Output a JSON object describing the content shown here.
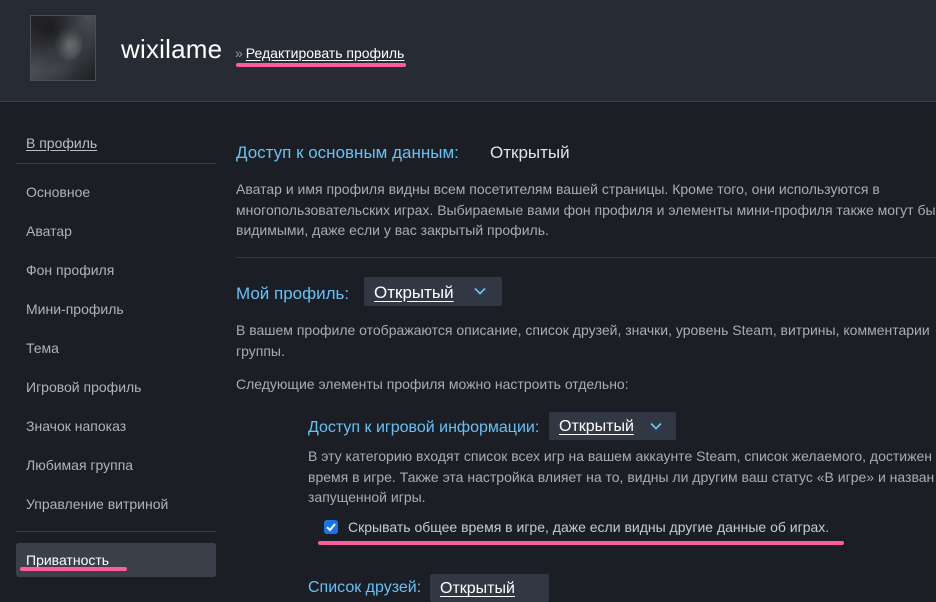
{
  "header": {
    "username": "wixilame",
    "crumb_sep": "»",
    "crumb_link": "Редактировать профиль"
  },
  "sidebar": {
    "back": "В профиль",
    "items": [
      "Основное",
      "Аватар",
      "Фон профиля",
      "Мини-профиль",
      "Тема",
      "Игровой профиль",
      "Значок напоказ",
      "Любимая группа",
      "Управление витриной"
    ],
    "active": "Приватность"
  },
  "main": {
    "basic": {
      "label": "Доступ к основным данным:",
      "value": "Открытый",
      "desc": [
        "Аватар и имя профиля видны всем посетителям вашей страницы. Кроме того, они используются в",
        "многопользовательских играх. Выбираемые вами фон профиля и элементы мини-профиля также могут бы",
        "видимыми, даже если у вас закрытый профиль."
      ]
    },
    "profile": {
      "label": "Мой профиль:",
      "value": "Открытый",
      "desc": [
        "В вашем профиле отображаются описание, список друзей, значки, уровень Steam, витрины, комментарии",
        "группы."
      ],
      "note": "Следующие элементы профиля можно настроить отдельно:"
    },
    "game": {
      "label": "Доступ к игровой информации:",
      "value": "Открытый",
      "desc": [
        "В эту категорию входят список всех игр на вашем аккаунте Steam, список желаемого, достижен",
        "время в игре. Также эта настройка влияет на то, видны ли другим ваш статус «В игре» и назван",
        "запущенной игры."
      ],
      "checkbox_label": "Скрывать общее время в игре, даже если видны другие данные об играх.",
      "checkbox_checked": true
    },
    "friends": {
      "label": "Список друзей:",
      "value": "Открытый"
    }
  },
  "colors": {
    "accent": "#67c1f5",
    "highlight": "#ff5c9c",
    "checkbox": "#1a73e8"
  }
}
